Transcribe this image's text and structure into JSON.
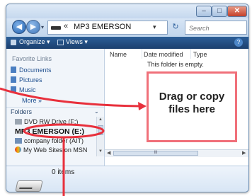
{
  "window": {
    "title_buttons": {
      "minimize": "–",
      "maximize": "□",
      "close": "✕"
    },
    "address": {
      "path_prefix": "«",
      "current_folder": "MP3 EMERSON",
      "search_placeholder": "Search"
    },
    "toolbar": {
      "organize": "Organize ▾",
      "views": "Views ▾",
      "help": "?"
    },
    "nav_pane": {
      "favorites_heading": "Favorite Links",
      "favorites": [
        "Documents",
        "Pictures",
        "Music"
      ],
      "more": "More »",
      "folders_heading": "Folders",
      "tree": [
        "DVD RW Drive (F:)",
        "MP3 EMERSON (E:)",
        "company folder (AIT)",
        "My Web Sites on MSN"
      ]
    },
    "content": {
      "columns": [
        "Name",
        "Date modified",
        "Type"
      ],
      "empty_message": "This folder is empty.",
      "hscroll_label": "III"
    },
    "details": {
      "items": "0 items"
    }
  },
  "callout": {
    "text": "Drag or copy\nfiles here"
  },
  "colors": {
    "accent_red": "#e8303c",
    "highlight_border": "#f0707a",
    "toolbar_blue": "#1f4b82"
  }
}
